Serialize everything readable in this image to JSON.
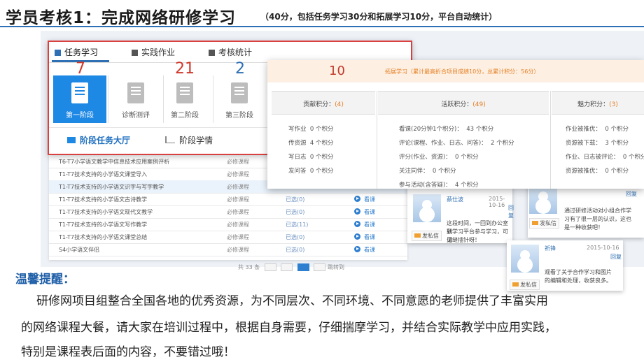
{
  "header": {
    "title": "学员考核1：完成网络研修学习",
    "subtitle": "（40分，包括任务学习30分和拓展学习10分，平台自动统计）"
  },
  "stage_window": {
    "tabs": [
      "任务学习",
      "实践作业",
      "考核统计"
    ],
    "numbers": [
      {
        "value": "7",
        "color": "#d0392b"
      },
      {
        "value": "21",
        "color": "#d0392b"
      },
      {
        "value": "2",
        "color": "#2f6fb3"
      }
    ],
    "stages": [
      "第一阶段",
      "诊断测评",
      "第二阶段",
      "第三阶段"
    ],
    "subtabs": [
      "阶段任务大厅",
      "阶段学情"
    ]
  },
  "course_list": {
    "rows": [
      {
        "name": "T6-T7小学语文教学中信息技术应用案例评析",
        "type": "必修课程",
        "status": "",
        "action": ""
      },
      {
        "name": "T1-T7技术支持的小学语文课堂导入",
        "type": "必修课程",
        "status": "",
        "action": ""
      },
      {
        "name": "T1-T7技术支持的小学语文识字与写字教学",
        "type": "必修课程",
        "status": "",
        "action": ""
      },
      {
        "name": "T1-T7技术支持的小学语文古诗教学",
        "type": "必修课程",
        "status": "已选(0)",
        "action": "看课"
      },
      {
        "name": "T1-T7技术支持的小学语文现代文教学",
        "type": "必修课程",
        "status": "已选(0)",
        "action": "看课"
      },
      {
        "name": "T1-T7技术支持的小学语文写作教学",
        "type": "必修课程",
        "status": "已选(11)",
        "action": "看课"
      },
      {
        "name": "T1-T7技术支持的小学语文课堂总结",
        "type": "必修课程",
        "status": "已选(0)",
        "action": "看课"
      },
      {
        "name": "S4小学语文伴侣",
        "type": "必修课程",
        "status": "已选(0)",
        "action": "看课"
      }
    ],
    "pager": {
      "total": "共 33 条",
      "pages": [
        "1",
        "2",
        "3",
        "4"
      ],
      "jump": "跳转到"
    }
  },
  "points_window": {
    "number": "10",
    "subtitle": "拓展学习（累计最高折合项目成绩10分，总累计积分：56分）",
    "columns": [
      {
        "title": "贡献积分：",
        "total": "(4)",
        "rows": [
          {
            "label": "写作业",
            "value": "0 个积分"
          },
          {
            "label": "传资源",
            "value": "4 个积分"
          },
          {
            "label": "写日志",
            "value": "0 个积分"
          },
          {
            "label": "发问答",
            "value": "0 个积分"
          }
        ]
      },
      {
        "title": "活跃积分：",
        "total": "(49)",
        "rows": [
          {
            "label": "看课(20分钟1个积分)：",
            "value": "43 个积分"
          },
          {
            "label": "评论(课程、作业、日志、问答)：",
            "value": "2 个积分"
          },
          {
            "label": "评分(作业、资源)：",
            "value": "0 个积分"
          },
          {
            "label": "关注同伴：",
            "value": "0 个积分"
          },
          {
            "label": "参与活动(含答疑)：",
            "value": "4 个积分"
          }
        ]
      },
      {
        "title": "魅力积分：",
        "total": "(3)",
        "rows": [
          {
            "label": "作业被推优：",
            "value": "0 个积分"
          },
          {
            "label": "资源被下载：",
            "value": "3 个积分"
          },
          {
            "label": "作业、日志被评论：",
            "value": "0 个积分"
          },
          {
            "label": "资源被推优：",
            "value": "0 个积分"
          }
        ]
      }
    ]
  },
  "comments": {
    "card1": {
      "name": "蔡仕波",
      "date": "2015-10-16",
      "reply": "回复",
      "text1": "这段时间，一回到办公室就",
      "text2": "到学习平台参与学习，可谓",
      "text3": "见缝插针呀！",
      "msg": "发私信"
    },
    "card2": {
      "reply": "回复",
      "text1": "通过研修活动对小组合作学",
      "text2": "习有了很一层的认识，这也",
      "text3": "是一种收获吧！",
      "msg": "发私信"
    },
    "card3": {
      "name": "祈锋",
      "date": "2015-10-16",
      "reply": "回复",
      "text1": "观看了关于合作学习和图片",
      "text2": "的编辑和处理，收获良多。",
      "msg": "发私信"
    }
  },
  "tip": {
    "title": "温馨提醒：",
    "line1": "研修网项目组整合全国各地的优秀资源，为不同层次、不同环境、不同意愿的老师提供了丰富实用",
    "line2": "的网络课程大餐，请大家在培训过程中，根据自身需要，仔细揣摩学习，并结合实际教学中应用实践，",
    "line3": "特别是课程表后面的内容，不要错过哦！"
  }
}
